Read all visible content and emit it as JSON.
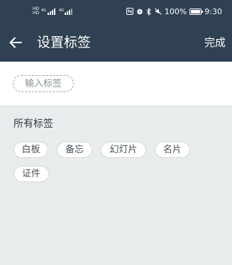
{
  "status_bar": {
    "sim1_label": "HD",
    "sim1_network": "4G",
    "sim2_label": "HD",
    "battery_percent": "100%",
    "battery_level": 1.0,
    "time": "9:30"
  },
  "toolbar": {
    "title": "设置标签",
    "done_label": "完成"
  },
  "tag_input": {
    "placeholder": "输入标签"
  },
  "all_tags": {
    "title": "所有标签",
    "tags": [
      "白板",
      "备忘",
      "幻灯片",
      "名片",
      "证件"
    ]
  },
  "colors": {
    "header_bg": "#2f4152",
    "page_bg": "#e9eced"
  }
}
